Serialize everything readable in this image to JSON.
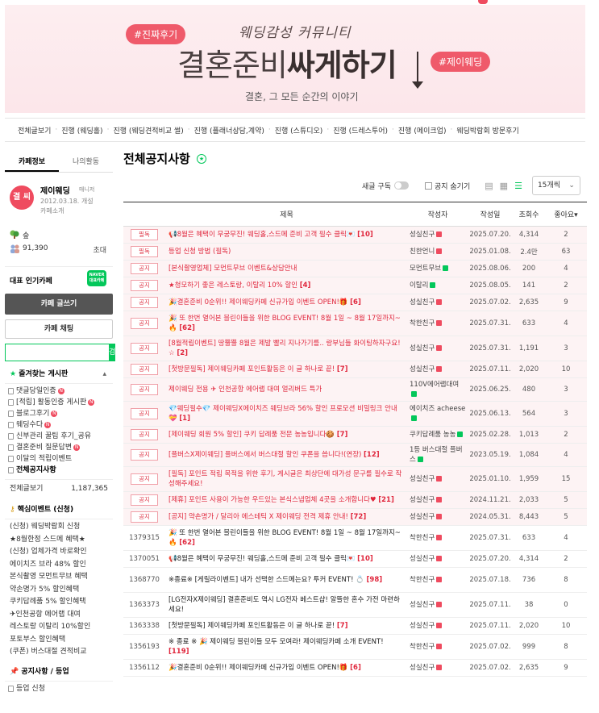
{
  "banner": {
    "tag_left": "#진짜후기",
    "tag_right": "#제이웨딩",
    "subtitle": "웨딩감성 커뮤니티",
    "title_normal": "결혼준비",
    "title_bold": "싸게하기",
    "desc": "결혼, 그 모든 순간의 이야기"
  },
  "nav": [
    "전체글보기",
    "진행 (웨딩홀)",
    "진행 (웨딩견적비교 썰)",
    "진행 (플래너상담,계약)",
    "진행 (스튜디오)",
    "진행 (드레스투어)",
    "진행 (메이크업)",
    "웨딩박람회 방문후기"
  ],
  "sidebar": {
    "tabs": [
      "카페정보",
      "나의활동"
    ],
    "avatar_text": "결 씨",
    "cafe_name": "제이웨딩",
    "role": "매니저",
    "since": "2012.03.18. 개설",
    "intro": "카페소개",
    "rank_label": "숲",
    "members": "91,390",
    "invite": "초대",
    "popular_label": "대표 인기카페",
    "naver_badge": "NAVER 대표카페",
    "write_button": "카페 글쓰기",
    "chat_button": "카페 채팅",
    "search_placeholder": "",
    "search_button": "검색",
    "fav_title": "즐겨찾는 게시판",
    "fav_items": [
      {
        "label": "댓글당일인증",
        "new": true,
        "bold": false
      },
      {
        "label": "[적립] 활동인증 게시판",
        "new": true,
        "bold": false
      },
      {
        "label": "블로그후기",
        "new": true,
        "bold": false
      },
      {
        "label": "웨딩수다",
        "new": true,
        "bold": false
      },
      {
        "label": "신부관리 꿀팁 후기_공유",
        "new": false,
        "bold": false
      },
      {
        "label": "결혼준비 질문답변",
        "new": true,
        "bold": false
      },
      {
        "label": "이달의 적립이벤트",
        "new": false,
        "bold": false
      },
      {
        "label": "전체공지사항",
        "new": false,
        "bold": true
      }
    ],
    "total_label": "전체글보기",
    "total_count": "1,187,365",
    "event_title": "핵심이벤트 (신청)",
    "event_items": [
      "(신청) 웨딩박람회 신청",
      "★8월한정 스드메 혜택★",
      "(신청) 업체가격 바로확인",
      "에이치즈 브라 48% 할인",
      "본식촬영 모먼트무브 혜택",
      "약손명가 5% 할인혜택",
      "쿠키답례품 5% 할인혜택",
      "✈인천공항 에어랩 대여",
      "레스토랑 이탈리 10%할인",
      "포토부스 할인혜택",
      "(쿠폰) 버스대절 견적비교"
    ],
    "notice_title": "공지사항 / 등업",
    "notice_items": [
      "등업 신청"
    ]
  },
  "main": {
    "title": "전체공지사항",
    "subscribe_label": "새글 구독",
    "hide_notice_label": "공지 숨기기",
    "per_page": "15개씩",
    "headers": [
      "제목",
      "작성자",
      "작성일",
      "조회수",
      "좋아요"
    ],
    "notices": [
      {
        "badge": "필독",
        "title": "📢8월은 혜택이 무궁무진! 웨딩홀,스드메 준비 고객 필수 클릭💌",
        "count": "[10]",
        "author": "성실친구",
        "lv": "r",
        "date": "2025.07.20.",
        "views": "4,314",
        "likes": "2"
      },
      {
        "badge": "필독",
        "title": "등업 신청 방법 (필독)",
        "count": "",
        "author": "친한언니",
        "lv": "r",
        "date": "2025.01.08.",
        "views": "2.4만",
        "likes": "63"
      },
      {
        "badge": "공지",
        "title": "[본식촬영업체] 모먼트무브 이벤트&상담안내",
        "count": "",
        "author": "모먼트무브",
        "lv": "g",
        "date": "2025.08.06.",
        "views": "200",
        "likes": "4"
      },
      {
        "badge": "공지",
        "title": "★청모하기 좋은 레스토랑, 이탈리 10% 할인",
        "count": "[4]",
        "author": "이탈리",
        "lv": "g",
        "date": "2025.08.05.",
        "views": "141",
        "likes": "2"
      },
      {
        "badge": "공지",
        "title": "🎉결혼준비 0순위!! 제이웨딩카페 신규가입 이벤트 OPEN!🎁",
        "count": "[6]",
        "author": "성실친구",
        "lv": "r",
        "date": "2025.07.02.",
        "views": "2,635",
        "likes": "9"
      },
      {
        "badge": "공지",
        "title": "🎉 또 한번 열어본 블린이들을 위한 BLOG EVENT! 8월 1일 ~ 8월 17일까지~🔥",
        "count": "[62]",
        "author": "착한친구",
        "lv": "r",
        "date": "2025.07.31.",
        "views": "633",
        "likes": "4"
      },
      {
        "badge": "공지",
        "title": "[8월적립이벤트] 땅뿔뿔 8월은 제발 빨리 지나가기를.. 랑부님들 화이팅하자구요!☆",
        "count": "[2]",
        "author": "성실친구",
        "lv": "r",
        "date": "2025.07.31.",
        "views": "1,191",
        "likes": "3"
      },
      {
        "badge": "공지",
        "title": "[첫방문필독] 제이웨딩카페 포인트활동은 이 글 하나로 끝!",
        "count": "[7]",
        "author": "성실친구",
        "lv": "r",
        "date": "2025.07.11.",
        "views": "2,020",
        "likes": "10"
      },
      {
        "badge": "공지",
        "title": "제이웨딩 전용 ✈ 인천공항 에어랩 대여 얼리버드 특가",
        "count": "",
        "author": "110V에어랩대여",
        "lv": "g",
        "date": "2025.06.25.",
        "views": "480",
        "likes": "3"
      },
      {
        "badge": "공지",
        "title": "💎웨딩필수💎 제이웨딩X에이치즈 웨딩브라 56% 할인 프로모션 비밀링크 안내 💝",
        "count": "[1]",
        "author": "에이치즈 acheese",
        "lv": "g",
        "date": "2025.06.13.",
        "views": "564",
        "likes": "3"
      },
      {
        "badge": "공지",
        "title": "[제이웨딩 회원 5% 할인] 쿠키 답례품 전문 농농입니다🍪",
        "count": "[7]",
        "author": "쿠키답례품 농농",
        "lv": "g",
        "date": "2025.02.28.",
        "views": "1,013",
        "likes": "2"
      },
      {
        "badge": "공지",
        "title": "[플버스X제이웨딩] 플버스에서 버스대절 할인 쿠폰을 씁니다!(연장)",
        "count": "[12]",
        "author": "1등 버스대절 플버스",
        "lv": "g",
        "date": "2023.05.19.",
        "views": "1,084",
        "likes": "4"
      },
      {
        "badge": "공지",
        "title": "[필독] 포인트 적립 목적을 위한 후기, 게시글은 최상단에 대가성 문구를 필수로 작성해주세요!",
        "count": "",
        "author": "성실친구",
        "lv": "r",
        "date": "2025.01.10.",
        "views": "1,959",
        "likes": "15"
      },
      {
        "badge": "공지",
        "title": "[제휴] 포인트 사용이 가능한 우드있는 본식스냅업체 4곳을 소개합니다♥",
        "count": "[21]",
        "author": "성실친구",
        "lv": "r",
        "date": "2024.11.21.",
        "views": "2,033",
        "likes": "5"
      },
      {
        "badge": "공지",
        "title": "[공지] 약손명가 / 달리아 에스테틱 X 제이웨딩 전격 제휴 안내!",
        "count": "[72]",
        "author": "성실친구",
        "lv": "r",
        "date": "2024.05.31.",
        "views": "8,443",
        "likes": "5"
      }
    ],
    "posts": [
      {
        "no": "1379315",
        "title": "🎉 또 한번 열어본 블린이들을 위한 BLOG EVENT! 8월 1일 ~ 8월 17일까지~🔥",
        "count": "[62]",
        "author": "착한친구",
        "lv": "r",
        "date": "2025.07.31.",
        "views": "633",
        "likes": "4"
      },
      {
        "no": "1370051",
        "title": "📢8월은 혜택이 무궁무진! 웨딩홀,스드메 준비 고객 필수 클릭💌",
        "count": "[10]",
        "author": "성실친구",
        "lv": "r",
        "date": "2025.07.20.",
        "views": "4,314",
        "likes": "2"
      },
      {
        "no": "1368770",
        "title": "※종료※ [게릴라이벤트] 내가 선택한 스드메는요? 투커 EVENT! 💍",
        "count": "[98]",
        "author": "착한친구",
        "lv": "r",
        "date": "2025.07.18.",
        "views": "736",
        "likes": "8"
      },
      {
        "no": "1363373",
        "title": "[LG전자X제이웨딩] 결혼준비도 역시 LG전자 베스트샵! 알뜰한 혼수 가전 마련하세요!",
        "count": "",
        "author": "성실친구",
        "lv": "r",
        "date": "2025.07.11.",
        "views": "38",
        "likes": "0"
      },
      {
        "no": "1363338",
        "title": "[첫방문필독] 제이웨딩카페 포인트활동은 이 글 하나로 끝!",
        "count": "[7]",
        "author": "성실친구",
        "lv": "r",
        "date": "2025.07.11.",
        "views": "2,020",
        "likes": "10"
      },
      {
        "no": "1356193",
        "title": "※ 종료 ※ 🎉 제이웨딩 블린이들 모두 모여라! 제이웨딩카페 소개 EVENT!",
        "count": "[119]",
        "author": "착한친구",
        "lv": "r",
        "date": "2025.07.02.",
        "views": "999",
        "likes": "8"
      },
      {
        "no": "1356112",
        "title": "🎉결혼준비 0순위!! 제이웨딩카페 신규가입 이벤트 OPEN!🎁",
        "count": "[6]",
        "author": "성실친구",
        "lv": "r",
        "date": "2025.07.02.",
        "views": "2,635",
        "likes": "9"
      }
    ]
  },
  "colors": {
    "accent": "#ef4b5f",
    "green": "#03c75a",
    "notice_bg": "#fdf3f4"
  }
}
